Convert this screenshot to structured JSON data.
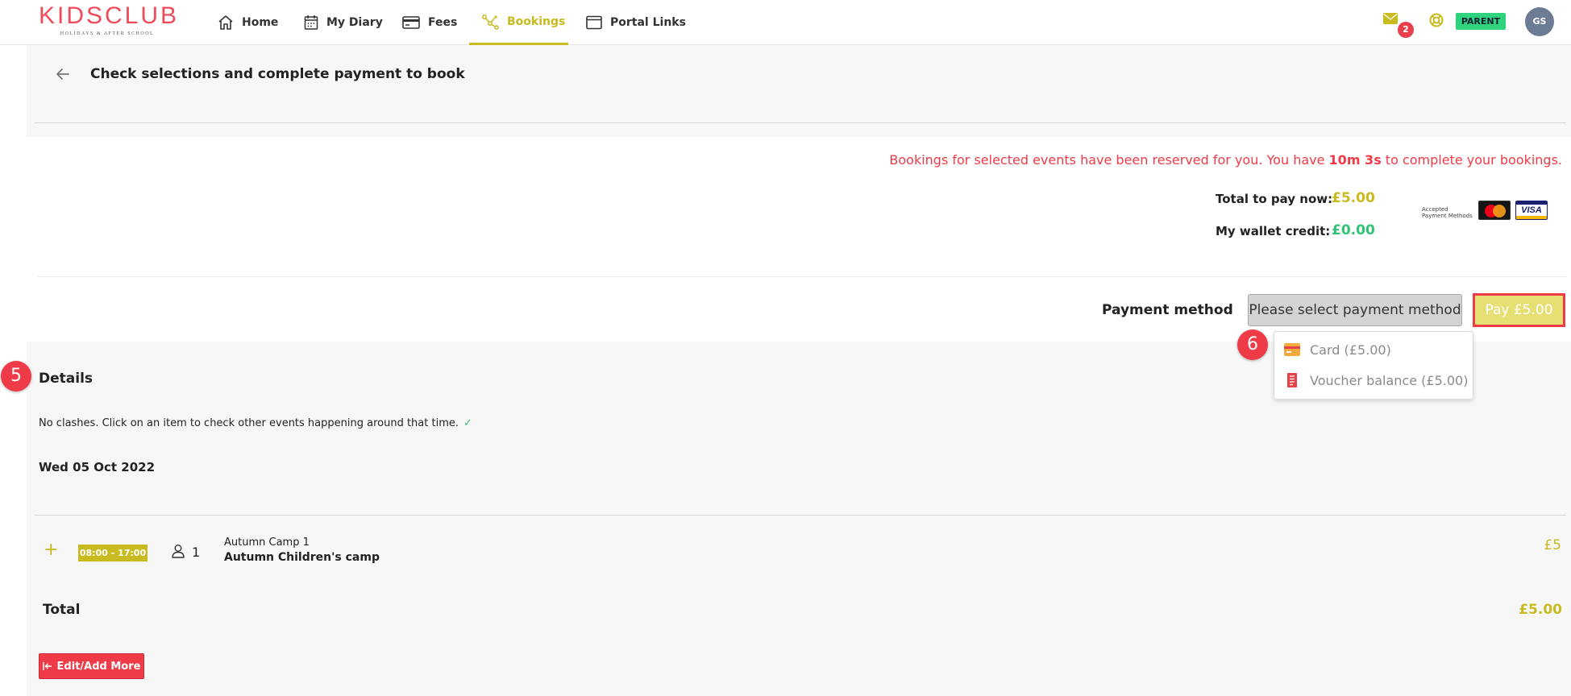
{
  "brand": {
    "logo_text": "KIDSCLUB",
    "logo_sub": "HOLIDAYS & AFTER SCHOOL",
    "accent_color": "#c9ba1f",
    "danger_color": "#ef3b47",
    "success_color": "#2fc476"
  },
  "nav": {
    "items": [
      {
        "label": "Home",
        "icon": "home-icon"
      },
      {
        "label": "My Diary",
        "icon": "calendar-icon"
      },
      {
        "label": "Fees",
        "icon": "card-icon"
      },
      {
        "label": "Bookings",
        "icon": "bookings-icon",
        "active": true
      },
      {
        "label": "Portal Links",
        "icon": "browser-icon"
      }
    ],
    "mail_count": "2",
    "role": "PARENT",
    "avatar_initials": "GS"
  },
  "page": {
    "title": "Check selections and complete payment to book"
  },
  "payment": {
    "reserve_msg_pre": "Bookings for selected events have been reserved for you. You have ",
    "reserve_time": "10m 3s",
    "reserve_msg_post": " to complete your bookings.",
    "total_label": "Total to pay now:",
    "total_value": "£5.00",
    "wallet_label": "My wallet credit:",
    "wallet_value": "£0.00",
    "accepted_line1": "Accepted",
    "accepted_line2": "Payment Methods",
    "visa_text": "VISA",
    "method_label": "Payment method",
    "select_placeholder": "Please select payment method",
    "pay_button": "Pay £5.00",
    "options": [
      {
        "label": "Card (£5.00)",
        "icon": "credit-card-icon"
      },
      {
        "label": "Voucher balance (£5.00)",
        "icon": "voucher-icon"
      }
    ]
  },
  "steps": {
    "details_step": "5",
    "dropdown_step": "6"
  },
  "details": {
    "title": "Details",
    "clash_msg": "No clashes. Click on an item to check other events happening around that time.",
    "check_mark": "✓",
    "date": "Wed 05 Oct 2022",
    "events": [
      {
        "plus": "+",
        "time": "08:00 - 17:00",
        "attendees": "1",
        "subtitle": "Autumn Camp 1",
        "name": "Autumn Children's camp",
        "price": "£5"
      }
    ],
    "total_label": "Total",
    "total_value": "£5.00",
    "edit_button": "Edit/Add More"
  }
}
